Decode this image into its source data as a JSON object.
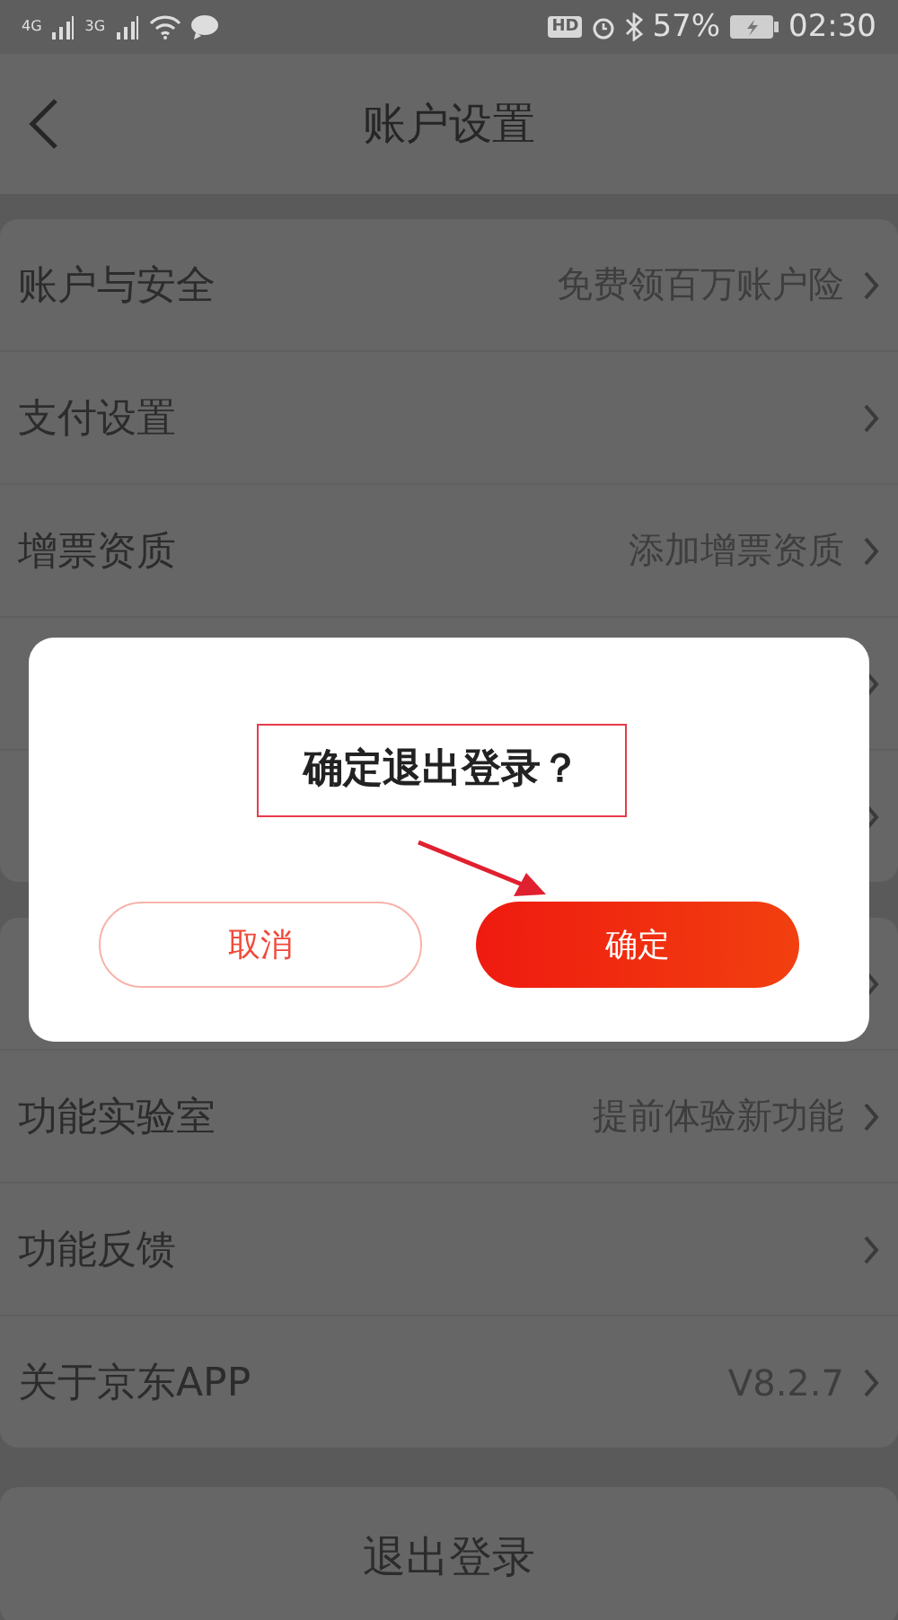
{
  "status_bar": {
    "networks": [
      "4G",
      "3G"
    ],
    "hd": "HD",
    "battery": "57%",
    "time": "02:30"
  },
  "header": {
    "title": "账户设置"
  },
  "groups": [
    {
      "rows": [
        {
          "label": "账户与安全",
          "value": "免费领百万账户险"
        },
        {
          "label": "支付设置"
        },
        {
          "label": "增票资质",
          "value": "添加增票资质"
        },
        {},
        {}
      ]
    },
    {
      "rows": [
        {},
        {
          "label": "功能实验室",
          "value": "提前体验新功能"
        },
        {
          "label": "功能反馈"
        },
        {
          "label": "关于京东APP",
          "value": "V8.2.7"
        }
      ]
    }
  ],
  "logout_button": "退出登录",
  "dialog": {
    "message": "确定退出登录？",
    "buttons": [
      {
        "label": "取消",
        "kind": "secondary"
      },
      {
        "label": "确定",
        "kind": "primary"
      }
    ],
    "annotations": {
      "highlight_box": true,
      "arrow": true
    }
  }
}
